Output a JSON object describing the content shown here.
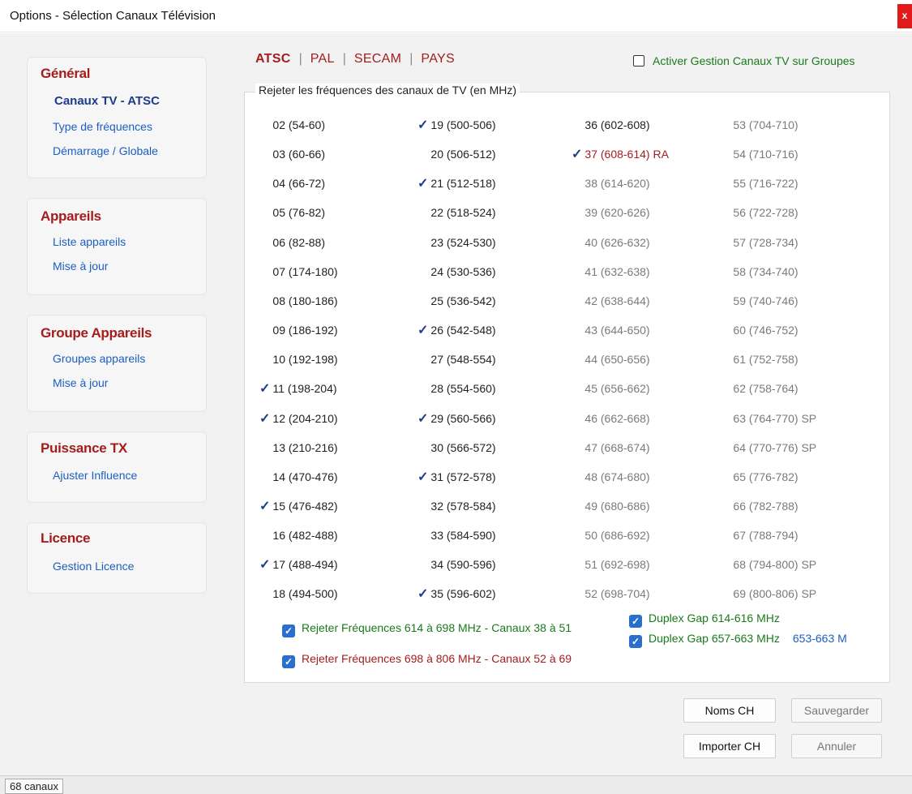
{
  "window": {
    "title": "Options - Sélection Canaux Télévision",
    "close_label": "x"
  },
  "sidebar": {
    "sections": [
      {
        "title": "Général",
        "items": [
          "Canaux TV - ATSC",
          "Type de fréquences",
          "Démarrage / Globale"
        ]
      },
      {
        "title": "Appareils",
        "items": [
          "Liste appareils",
          "Mise à jour"
        ]
      },
      {
        "title": "Groupe Appareils",
        "items": [
          "Groupes appareils",
          "Mise à jour"
        ]
      },
      {
        "title": "Puissance TX",
        "items": [
          "Ajuster Influence"
        ]
      },
      {
        "title": "Licence",
        "items": [
          "Gestion Licence"
        ]
      }
    ],
    "active_item": "Canaux TV - ATSC"
  },
  "tabs": [
    "ATSC",
    "PAL",
    "SECAM",
    "PAYS"
  ],
  "active_tab": "ATSC",
  "group_checkbox": {
    "label": "Activer Gestion Canaux TV sur Groupes",
    "checked": false
  },
  "group_title": "Rejeter les fréquences des canaux de TV (en MHz)",
  "channels": [
    [
      {
        "label": "02 (54-60)",
        "checked": false,
        "style": "normal"
      },
      {
        "label": "03 (60-66)",
        "checked": false,
        "style": "normal"
      },
      {
        "label": "04 (66-72)",
        "checked": false,
        "style": "normal"
      },
      {
        "label": "05 (76-82)",
        "checked": false,
        "style": "normal"
      },
      {
        "label": "06 (82-88)",
        "checked": false,
        "style": "normal"
      },
      {
        "label": "07 (174-180)",
        "checked": false,
        "style": "normal"
      },
      {
        "label": "08 (180-186)",
        "checked": false,
        "style": "normal"
      },
      {
        "label": "09 (186-192)",
        "checked": false,
        "style": "normal"
      },
      {
        "label": "10 (192-198)",
        "checked": false,
        "style": "normal"
      },
      {
        "label": "11 (198-204)",
        "checked": true,
        "style": "normal"
      },
      {
        "label": "12 (204-210)",
        "checked": true,
        "style": "normal"
      },
      {
        "label": "13 (210-216)",
        "checked": false,
        "style": "normal"
      },
      {
        "label": "14 (470-476)",
        "checked": false,
        "style": "normal"
      },
      {
        "label": "15 (476-482)",
        "checked": true,
        "style": "normal"
      },
      {
        "label": "16 (482-488)",
        "checked": false,
        "style": "normal"
      },
      {
        "label": "17 (488-494)",
        "checked": true,
        "style": "normal"
      },
      {
        "label": "18 (494-500)",
        "checked": false,
        "style": "normal"
      }
    ],
    [
      {
        "label": "19 (500-506)",
        "checked": true,
        "style": "normal"
      },
      {
        "label": "20 (506-512)",
        "checked": false,
        "style": "normal"
      },
      {
        "label": "21 (512-518)",
        "checked": true,
        "style": "normal"
      },
      {
        "label": "22 (518-524)",
        "checked": false,
        "style": "normal"
      },
      {
        "label": "23 (524-530)",
        "checked": false,
        "style": "normal"
      },
      {
        "label": "24 (530-536)",
        "checked": false,
        "style": "normal"
      },
      {
        "label": "25 (536-542)",
        "checked": false,
        "style": "normal"
      },
      {
        "label": "26 (542-548)",
        "checked": true,
        "style": "normal"
      },
      {
        "label": "27 (548-554)",
        "checked": false,
        "style": "normal"
      },
      {
        "label": "28 (554-560)",
        "checked": false,
        "style": "normal"
      },
      {
        "label": "29 (560-566)",
        "checked": true,
        "style": "normal"
      },
      {
        "label": "30 (566-572)",
        "checked": false,
        "style": "normal"
      },
      {
        "label": "31 (572-578)",
        "checked": true,
        "style": "normal"
      },
      {
        "label": "32 (578-584)",
        "checked": false,
        "style": "normal"
      },
      {
        "label": "33 (584-590)",
        "checked": false,
        "style": "normal"
      },
      {
        "label": "34 (590-596)",
        "checked": false,
        "style": "normal"
      },
      {
        "label": "35 (596-602)",
        "checked": true,
        "style": "normal"
      }
    ],
    [
      {
        "label": "36 (602-608)",
        "checked": false,
        "style": "normal"
      },
      {
        "label": "37 (608-614) RA",
        "checked": true,
        "style": "red"
      },
      {
        "label": "38 (614-620)",
        "checked": false,
        "style": "gray"
      },
      {
        "label": "39 (620-626)",
        "checked": false,
        "style": "gray"
      },
      {
        "label": "40 (626-632)",
        "checked": false,
        "style": "gray"
      },
      {
        "label": "41 (632-638)",
        "checked": false,
        "style": "gray"
      },
      {
        "label": "42 (638-644)",
        "checked": false,
        "style": "gray"
      },
      {
        "label": "43 (644-650)",
        "checked": false,
        "style": "gray"
      },
      {
        "label": "44 (650-656)",
        "checked": false,
        "style": "gray"
      },
      {
        "label": "45 (656-662)",
        "checked": false,
        "style": "gray"
      },
      {
        "label": "46 (662-668)",
        "checked": false,
        "style": "gray"
      },
      {
        "label": "47 (668-674)",
        "checked": false,
        "style": "gray"
      },
      {
        "label": "48 (674-680)",
        "checked": false,
        "style": "gray"
      },
      {
        "label": "49 (680-686)",
        "checked": false,
        "style": "gray"
      },
      {
        "label": "50 (686-692)",
        "checked": false,
        "style": "gray"
      },
      {
        "label": "51 (692-698)",
        "checked": false,
        "style": "gray"
      },
      {
        "label": "52 (698-704)",
        "checked": false,
        "style": "gray"
      }
    ],
    [
      {
        "label": "53 (704-710)",
        "checked": false,
        "style": "gray"
      },
      {
        "label": "54 (710-716)",
        "checked": false,
        "style": "gray"
      },
      {
        "label": "55 (716-722)",
        "checked": false,
        "style": "gray"
      },
      {
        "label": "56 (722-728)",
        "checked": false,
        "style": "gray"
      },
      {
        "label": "57 (728-734)",
        "checked": false,
        "style": "gray"
      },
      {
        "label": "58 (734-740)",
        "checked": false,
        "style": "gray"
      },
      {
        "label": "59 (740-746)",
        "checked": false,
        "style": "gray"
      },
      {
        "label": "60 (746-752)",
        "checked": false,
        "style": "gray"
      },
      {
        "label": "61 (752-758)",
        "checked": false,
        "style": "gray"
      },
      {
        "label": "62 (758-764)",
        "checked": false,
        "style": "gray"
      },
      {
        "label": "63 (764-770) SP",
        "checked": false,
        "style": "gray"
      },
      {
        "label": "64 (770-776) SP",
        "checked": false,
        "style": "gray"
      },
      {
        "label": "65 (776-782)",
        "checked": false,
        "style": "gray"
      },
      {
        "label": "66 (782-788)",
        "checked": false,
        "style": "gray"
      },
      {
        "label": "67 (788-794)",
        "checked": false,
        "style": "gray"
      },
      {
        "label": "68 (794-800) SP",
        "checked": false,
        "style": "gray"
      },
      {
        "label": "69 (800-806) SP",
        "checked": false,
        "style": "gray"
      }
    ]
  ],
  "options": {
    "reject_614_698": {
      "label": "Rejeter Fréquences 614 à 698 MHz - Canaux 38 à 51",
      "checked": true
    },
    "reject_698_806": {
      "label": "Rejeter Fréquences 698 à 806 MHz - Canaux 52 à 69",
      "checked": true
    },
    "duplex_614_616": {
      "label": "Duplex Gap 614-616 MHz",
      "checked": true
    },
    "duplex_657_663": {
      "label": "Duplex Gap 657-663 MHz",
      "checked": true,
      "extra": "653-663 M"
    }
  },
  "buttons": {
    "noms_ch": "Noms CH",
    "sauvegarder": "Sauvegarder",
    "importer_ch": "Importer CH",
    "annuler": "Annuler"
  },
  "status": {
    "channel_count": "68 canaux"
  },
  "colors": {
    "accent_red": "#a41d1d",
    "link_blue": "#1b5fc1",
    "check_blue": "#2a6fcc",
    "green": "#1a7a1a",
    "gray": "#7a7a7a"
  },
  "icons": {
    "check": "checkmark-icon",
    "close": "close-icon"
  }
}
